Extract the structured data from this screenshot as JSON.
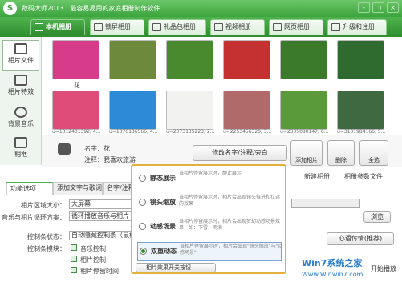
{
  "titlebar": {
    "app": "数码大师2013",
    "slogan": "最容易易用的家庭相册制作软件",
    "buttons": [
      "-",
      "□",
      "×"
    ]
  },
  "main_tabs": [
    {
      "label": "本机相册",
      "active": true,
      "icon": "photo-icon"
    },
    {
      "label": "锁屏相册",
      "icon": "monitor-icon"
    },
    {
      "label": "礼品包相册",
      "icon": "gift-icon"
    },
    {
      "label": "视频相册",
      "icon": "film-icon"
    },
    {
      "label": "网页相册",
      "icon": "web-icon"
    },
    {
      "label": "升级和注册",
      "icon": "upgrade-icon"
    }
  ],
  "sidebar": [
    {
      "label": "相片文件",
      "active": true,
      "icon": "camera-icon"
    },
    {
      "label": "相片特效",
      "icon": "sparkle-icon"
    },
    {
      "label": "背景音乐",
      "icon": "music-note-icon"
    },
    {
      "label": "相框",
      "icon": "frame-icon"
    }
  ],
  "photos": {
    "row1_caption": "花",
    "row2_captions": [
      "u=1012401392, 4...",
      "u=1076136566, 4...",
      "u=2073135223, 2...",
      "u=2253456320, 3...",
      "u=2305080147, 6...",
      "u=3101984166, 5..."
    ],
    "colors": [
      "#d63c8a",
      "#6d8a3c",
      "#4a8a2e",
      "#c53030",
      "#3a7a2a",
      "#2f6a2f",
      "#e04c7a",
      "#2c8ad6",
      "#f2f2f0",
      "#b06a6a",
      "#5a9a3a",
      "#3f6a3f"
    ]
  },
  "info": {
    "name_label": "名字：",
    "name_value": "花",
    "note_label": "注释：",
    "note_value": "我喜欢旅游",
    "edit_button": "修改名字/注释/旁白",
    "add_button": "添加相片",
    "delete_button": "删除",
    "select_all_button": "全选"
  },
  "settings_tabs": [
    "功能选项",
    "添加文字与歌词",
    "名字/注释"
  ],
  "settings": {
    "size_label": "相片区域大小：",
    "size_value": "大屏幕",
    "music_label": "音乐与相片循环方案：",
    "music_value": "循环播放音乐与相片",
    "control_label": "控制条状态：",
    "control_value": "自动隐藏控制条（鼠标",
    "module_label": "控制条模块：",
    "modules": [
      "音乐控制",
      "相片控制",
      "相片停留时间"
    ],
    "effect_toggle": "相片效果开关按钮"
  },
  "popup": {
    "options": [
      {
        "name": "静态展示",
        "desc": "当相片停留展示时，静止展示",
        "selected": false
      },
      {
        "name": "镜头缩放",
        "desc": "当相片停留展示时，相片会出现镜头推进和拉远的效果",
        "selected": false
      },
      {
        "name": "动感场景",
        "desc": "当相片停留展示时，相片会出现梦幻动感场景效果，如：下雪，雨滴",
        "selected": false
      },
      {
        "name": "双重动态",
        "desc": "当相片停留展示时，相片会出现\"镜头缩放\"与\"动感场景\"",
        "selected": true
      }
    ]
  },
  "right": {
    "new_album": "新建相册",
    "album_params": "相册参数文件",
    "browse": "浏览",
    "preview": "心语传情(推荐)",
    "play": "开始播放"
  },
  "watermark": {
    "brand": "Win7系统之家",
    "url": "Www.Winwin7.com"
  }
}
